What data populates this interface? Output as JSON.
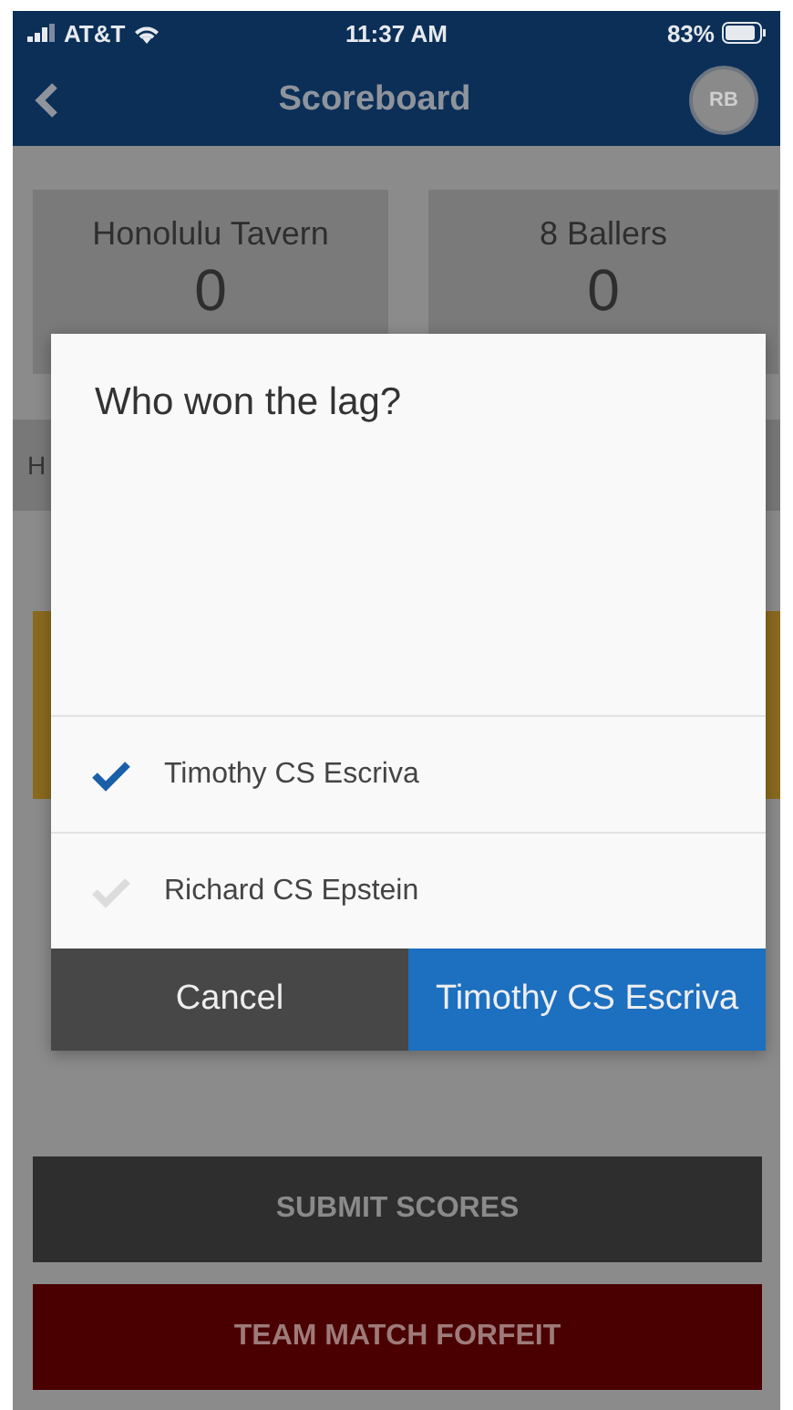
{
  "status_bar": {
    "carrier": "AT&T",
    "time": "11:37 AM",
    "battery": "83%"
  },
  "nav": {
    "title": "Scoreboard",
    "avatar": "RB"
  },
  "teams": [
    {
      "name": "Honolulu Tavern",
      "score": "0"
    },
    {
      "name": "8 Ballers",
      "score": "0"
    }
  ],
  "header_row": {
    "label": "H"
  },
  "dialog": {
    "title": "Who won the lag?",
    "options": [
      {
        "label": "Timothy CS Escriva",
        "selected": true
      },
      {
        "label": "Richard CS Epstein",
        "selected": false
      }
    ],
    "cancel": "Cancel",
    "confirm": "Timothy CS Escriva"
  },
  "buttons": [
    {
      "label": "SUBMIT SCORES",
      "kind": "submit"
    },
    {
      "label": "TEAM MATCH FORFEIT",
      "kind": "forfeit"
    }
  ]
}
